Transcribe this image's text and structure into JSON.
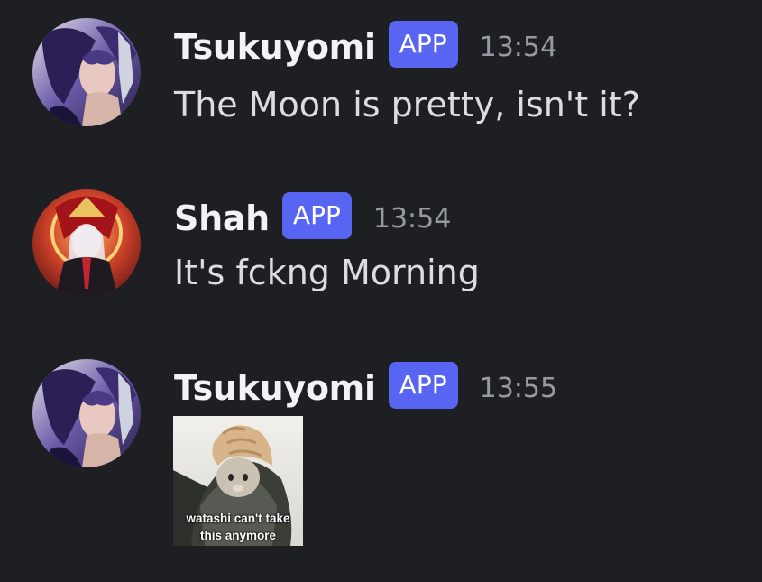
{
  "messages": [
    {
      "username": "Tsukuyomi",
      "badge": "APP",
      "timestamp": "13:54",
      "content": "The Moon is pretty, isn't it?",
      "avatar": "tsukuyomi-avatar"
    },
    {
      "username": "Shah",
      "badge": "APP",
      "timestamp": "13:54",
      "content": "It's fckng Morning",
      "avatar": "shah-avatar"
    },
    {
      "username": "Tsukuyomi",
      "badge": "APP",
      "timestamp": "13:55",
      "avatar": "tsukuyomi-avatar",
      "attachment": {
        "caption_line1": "watashi can't take",
        "caption_line2": "this anymore"
      }
    }
  ],
  "colors": {
    "background": "#1e1f22",
    "badge": "#5865f2",
    "username": "#f2f3f5",
    "timestamp": "#949ba4",
    "message_text": "#dbdee1"
  }
}
